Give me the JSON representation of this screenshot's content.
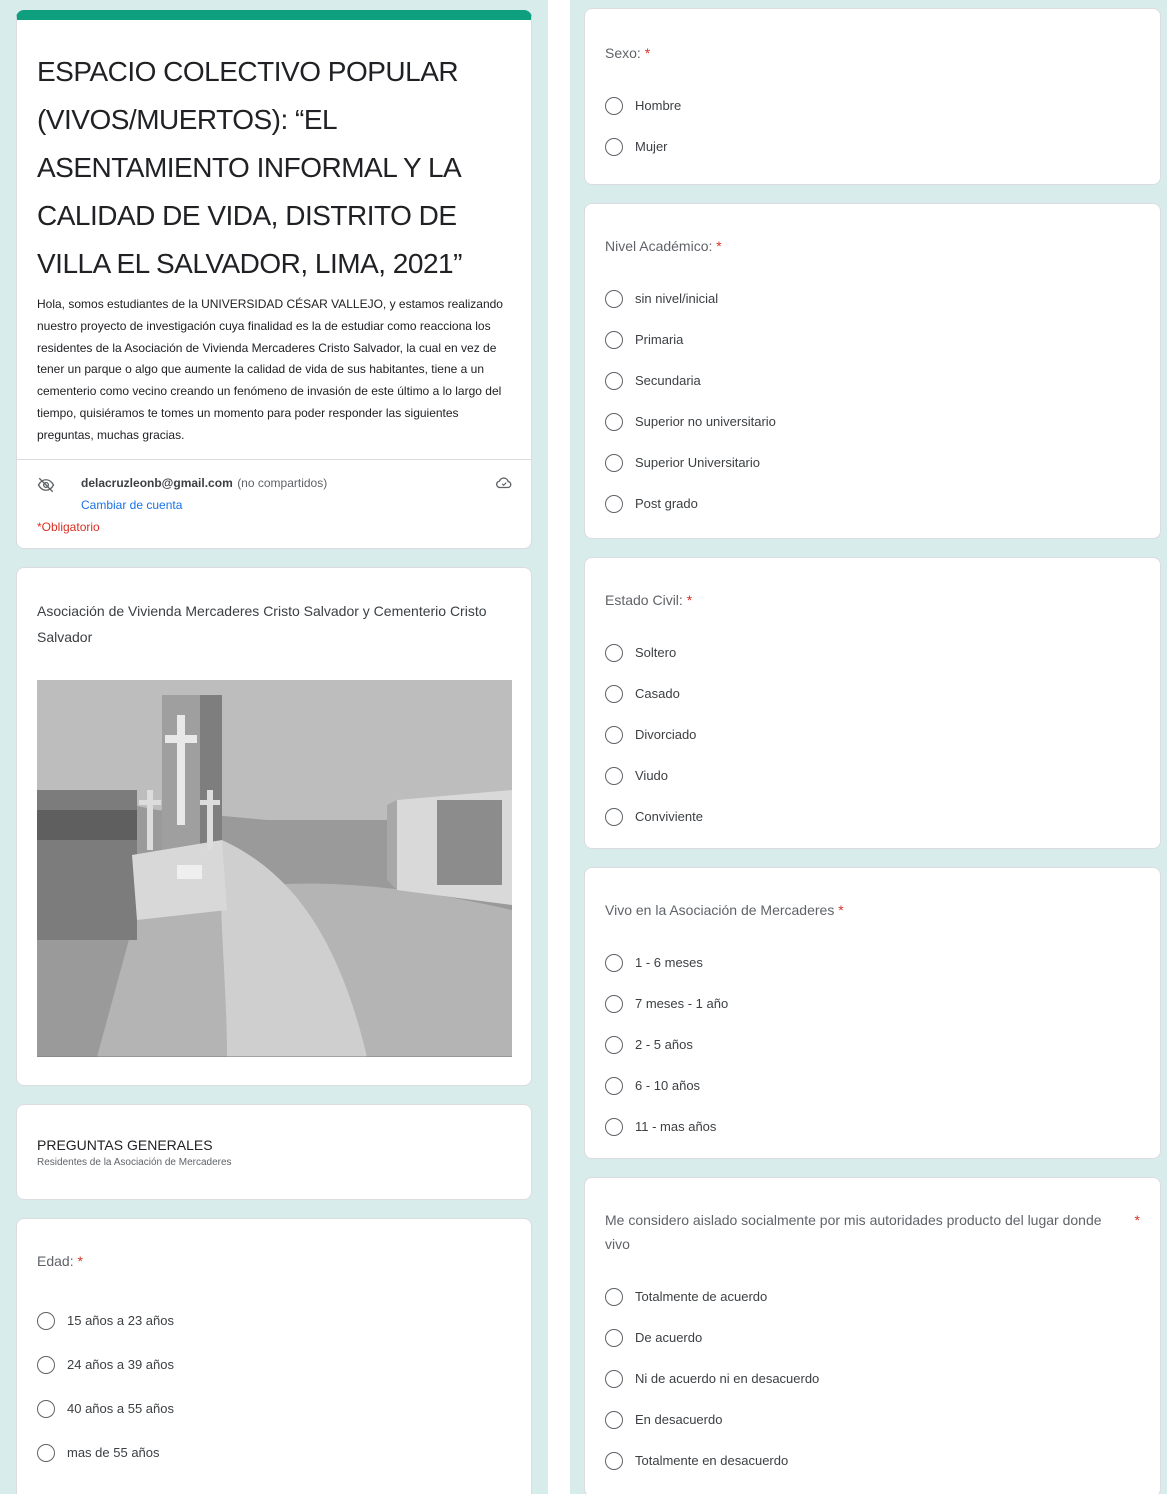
{
  "header": {
    "title": "ESPACIO COLECTIVO POPULAR (VIVOS/MUERTOS): “EL ASENTAMIENTO INFORMAL Y LA CALIDAD DE VIDA, DISTRITO DE VILLA EL SALVADOR, LIMA, 2021”",
    "description": "Hola, somos estudiantes de la UNIVERSIDAD CÉSAR VALLEJO, y estamos realizando nuestro proyecto de investigación cuya finalidad es la de estudiar como reacciona los residentes de la Asociación de Vivienda Mercaderes Cristo Salvador, la cual en vez  de tener un parque o algo que aumente la calidad de vida de sus habitantes, tiene a un cementerio como vecino creando un fenómeno de invasión de este último a lo largo del tiempo, quisiéramos te tomes un momento para poder responder las siguientes preguntas, muchas gracias.",
    "account_email": "delacruzleonb@gmail.com",
    "account_note": "(no compartidos)",
    "switch_account": "Cambiar de cuenta",
    "required_note": "*Obligatorio",
    "icons": {
      "hidden": "eye-off-icon",
      "cloud": "cloud-sync-icon"
    },
    "accent": "#0e9f7f"
  },
  "image_block": {
    "caption": "Asociación de Vivienda Mercaderes Cristo Salvador y Cementerio Cristo Salvador"
  },
  "section": {
    "title": "PREGUNTAS GENERALES",
    "subtitle": "Residentes de la Asociación de Mercaderes"
  },
  "questions": {
    "edad": {
      "title": "Edad: ",
      "required": "*",
      "options": [
        "15 años a 23 años",
        "24 años a 39 años",
        "40 años a 55 años",
        "mas de 55 años"
      ]
    },
    "sexo": {
      "title": "Sexo: ",
      "required": "*",
      "options": [
        "Hombre",
        "Mujer"
      ]
    },
    "nivel": {
      "title": "Nivel Académico: ",
      "required": "*",
      "options": [
        "sin nivel/inicial",
        "Primaria",
        "Secundaria",
        "Superior no universitario",
        "Superior Universitario",
        "Post grado"
      ]
    },
    "civil": {
      "title": "Estado Civil: ",
      "required": "*",
      "options": [
        "Soltero",
        "Casado",
        "Divorciado",
        "Viudo",
        "Conviviente"
      ]
    },
    "vivo": {
      "title": "Vivo en la Asociación de Mercaderes ",
      "required": "*",
      "options": [
        "1 - 6 meses",
        "7 meses - 1 año",
        "2 - 5 años",
        "6 - 10 años",
        "11 - mas años"
      ]
    },
    "aislado": {
      "title": "Me considero aislado socialmente por mis autoridades producto del lugar donde vivo",
      "required": "*",
      "options": [
        "Totalmente de acuerdo",
        "De acuerdo",
        "Ni de acuerdo ni en desacuerdo",
        "En desacuerdo",
        "Totalmente en desacuerdo"
      ]
    }
  },
  "colors": {
    "required": "#d93025",
    "link": "#1a73e8",
    "background": "#d9ecec"
  }
}
